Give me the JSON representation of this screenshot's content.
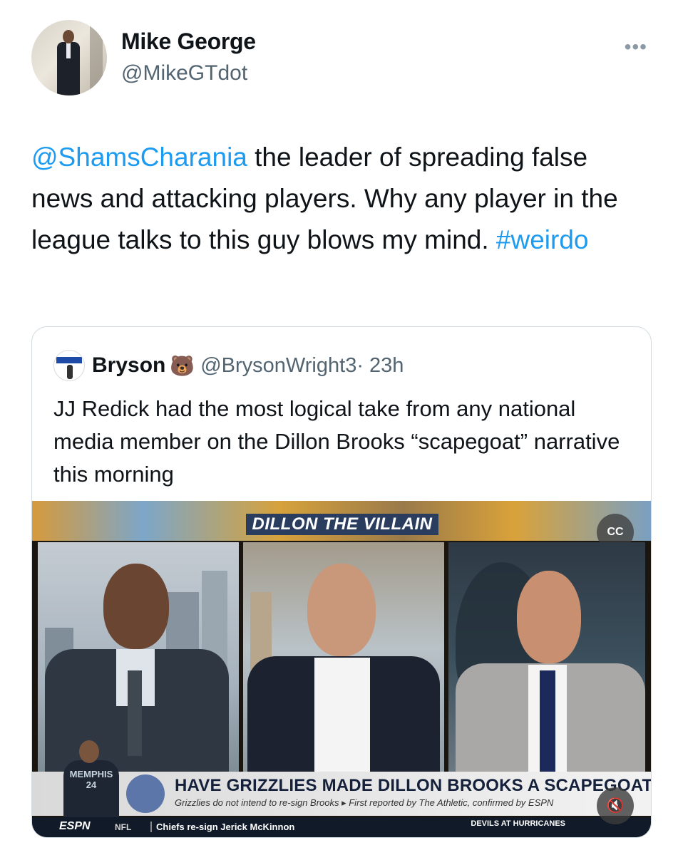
{
  "author": {
    "name": "Mike George",
    "handle": "@MikeGTdot",
    "more_icon": "more-horizontal-icon"
  },
  "tweet": {
    "mention": "@ShamsCharania",
    "text": " the leader of spreading false news and attacking players.  Why any player in the league talks to this guy blows my mind. ",
    "hashtag": "#weirdo"
  },
  "quote": {
    "name": "Bryson",
    "emoji": "🐻",
    "handle": "@BrysonWright3",
    "time": "· 23h",
    "text": "JJ Redick had the most logical take from any national media member on the Dillon Brooks “scapegoat” narrative this morning"
  },
  "video": {
    "banner_title": "DILLON THE VILLAIN",
    "cc_label": "CC",
    "jersey": "MEMPHIS 24",
    "headline": "HAVE GRIZZLIES MADE DILLON BROOKS A SCAPEGOAT?",
    "subline": "Grizzlies do not intend to re-sign Brooks ▸ First reported by The Athletic, confirmed by ESPN",
    "network": "ESPN",
    "ticker_league": "NFL",
    "ticker_text": "Chiefs re-sign Jerick McKinnon",
    "ticker_right": "DEVILS AT HURRICANES",
    "mute_icon": "speaker-muted-icon"
  }
}
